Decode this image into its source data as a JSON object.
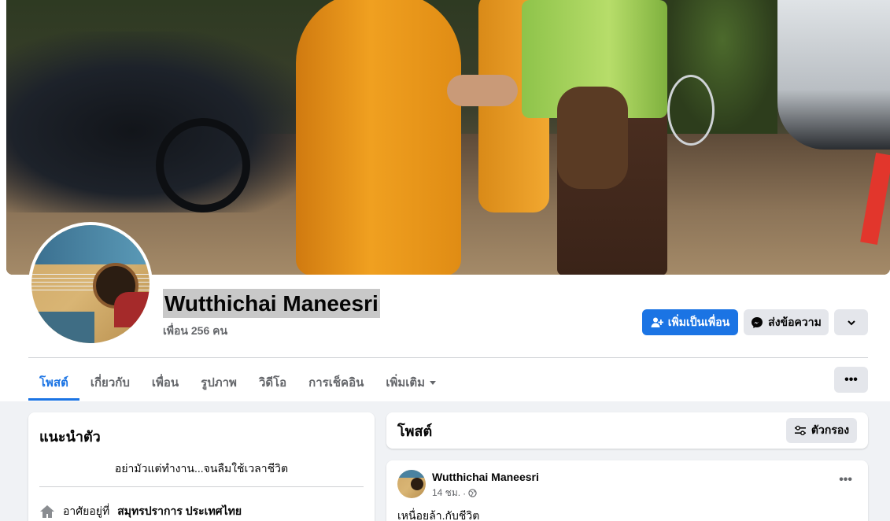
{
  "profile": {
    "name": "Wutthichai Maneesri",
    "friends_label": "เพื่อน 256 คน"
  },
  "actions": {
    "add_friend": "เพิ่มเป็นเพื่อน",
    "message": "ส่งข้อความ"
  },
  "tabs": [
    {
      "label": "โพสต์"
    },
    {
      "label": "เกี่ยวกับ"
    },
    {
      "label": "เพื่อน"
    },
    {
      "label": "รูปภาพ"
    },
    {
      "label": "วิดีโอ"
    },
    {
      "label": "การเช็คอิน"
    },
    {
      "label": "เพิ่มเติม"
    }
  ],
  "intro": {
    "title": "แนะนำตัว",
    "bio": "อย่ามัวแต่ทำงาน...จนลืมใช้เวลาชีวิต",
    "lives_prefix": "อาศัยอยู่ที่",
    "lives_place": "สมุทรปราการ ประเทศไทย"
  },
  "posts_section": {
    "title": "โพสต์",
    "filter_label": "ตัวกรอง"
  },
  "post": {
    "author": "Wutthichai Maneesri",
    "time": "14 ชม.",
    "text": "เหนื่อยล้า.กับชีวิต"
  },
  "colors": {
    "primary": "#1b74e4",
    "secondary_button": "#e4e6eb",
    "background": "#f0f2f5"
  }
}
